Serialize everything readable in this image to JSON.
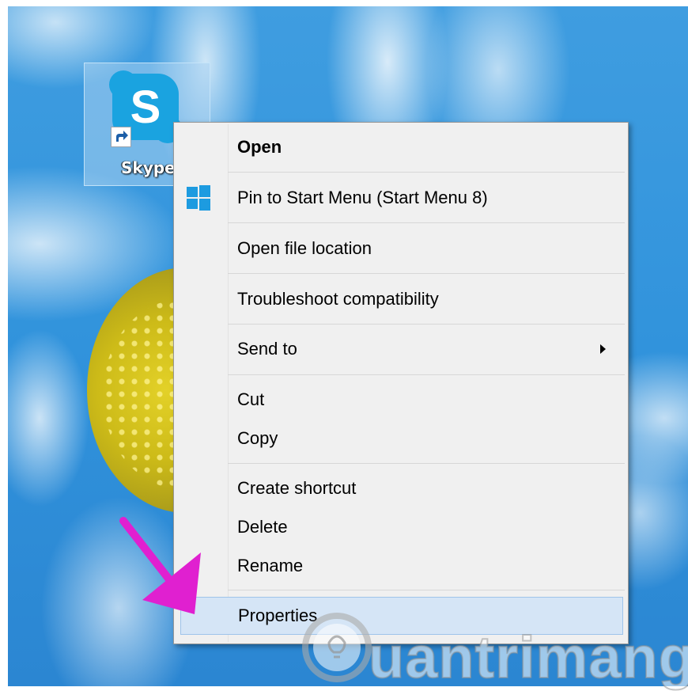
{
  "desktop": {
    "icon": {
      "name": "skype-icon",
      "label": "Skype"
    }
  },
  "context_menu": {
    "items": [
      {
        "label": "Open",
        "bold": true
      },
      {
        "label": "Pin to Start Menu (Start Menu 8)",
        "icon": "windows-logo-icon"
      },
      {
        "label": "Open file location"
      },
      {
        "label": "Troubleshoot compatibility"
      },
      {
        "label": "Send to",
        "has_submenu": true
      },
      {
        "label": "Cut"
      },
      {
        "label": "Copy"
      },
      {
        "label": "Create shortcut"
      },
      {
        "label": "Delete"
      },
      {
        "label": "Rename"
      },
      {
        "label": "Properties",
        "highlighted": true
      }
    ]
  },
  "annotation": {
    "arrow_color": "#e020d0"
  },
  "watermark": {
    "text": "uantrimang"
  },
  "colors": {
    "desktop_blue": "#3193dc",
    "menu_bg": "#f0f0f0",
    "highlight_bg": "#d5e5f6",
    "skype_blue": "#1aa3e0",
    "windows_logo": "#1d9be0"
  }
}
